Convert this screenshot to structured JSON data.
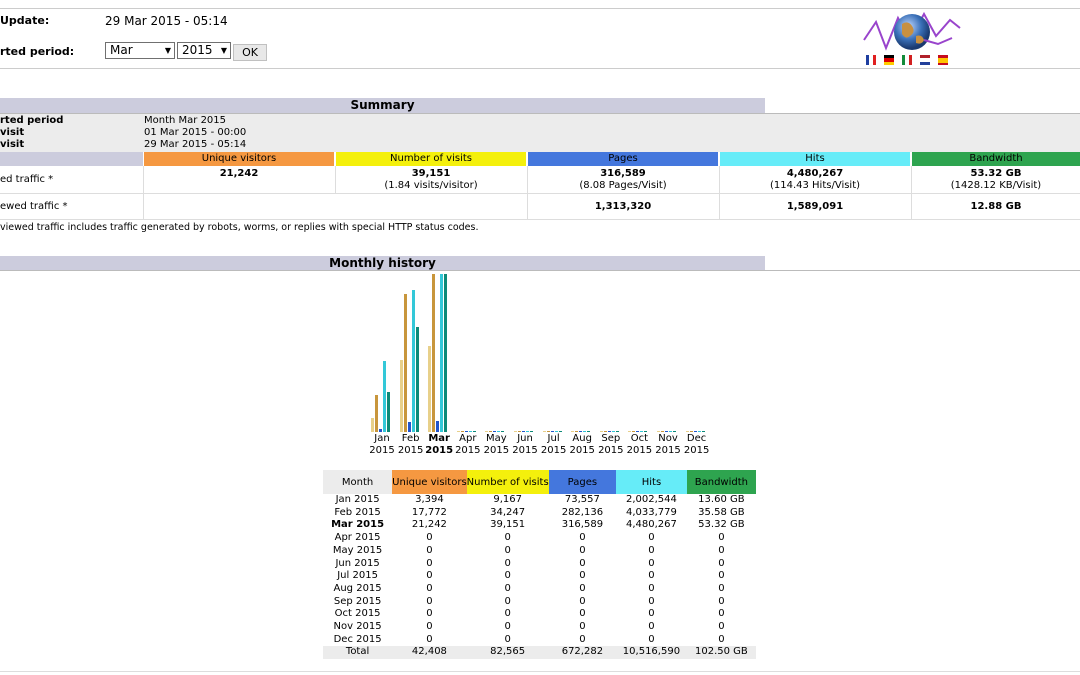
{
  "header": {
    "last_update_label": "Update:",
    "last_update_value": "29 Mar 2015 - 05:14",
    "period_label": "rted period:",
    "month_select": "Mar",
    "year_select": "2015",
    "ok_button": "OK",
    "logo_icon": "awstats-globe-logo",
    "flags": [
      "flag-fr-icon",
      "flag-de-icon",
      "flag-it-icon",
      "flag-nl-icon",
      "flag-es-icon"
    ]
  },
  "summary": {
    "title": "Summary",
    "info": [
      {
        "label": "rted period",
        "value": "Month Mar 2015"
      },
      {
        "label": "visit",
        "value": "01 Mar 2015 - 00:00"
      },
      {
        "label": "visit",
        "value": "29 Mar 2015 - 05:14"
      }
    ],
    "columns": [
      "Unique visitors",
      "Number of visits",
      "Pages",
      "Hits",
      "Bandwidth"
    ],
    "colors": {
      "visitors": "#f59841",
      "visits": "#f4f00c",
      "pages": "#4477dd",
      "hits": "#66ecf8",
      "bandwidth": "#2ea44f"
    },
    "viewed": {
      "label": "ed traffic *",
      "visitors": "21,242",
      "visits": "39,151",
      "visits_sub": "(1.84 visits/visitor)",
      "pages": "316,589",
      "pages_sub": "(8.08 Pages/Visit)",
      "hits": "4,480,267",
      "hits_sub": "(114.43 Hits/Visit)",
      "bandwidth": "53.32 GB",
      "bandwidth_sub": "(1428.12 KB/Visit)"
    },
    "notviewed": {
      "label": "ewed traffic *",
      "pages": "1,313,320",
      "hits": "1,589,091",
      "bandwidth": "12.88 GB"
    },
    "footnote": "viewed traffic includes traffic generated by robots, worms, or replies with special HTTP status codes."
  },
  "monthly": {
    "title": "Monthly history",
    "chart_labels": [
      [
        "Jan",
        "2015"
      ],
      [
        "Feb",
        "2015"
      ],
      [
        "Mar",
        "2015"
      ],
      [
        "Apr",
        "2015"
      ],
      [
        "May",
        "2015"
      ],
      [
        "Jun",
        "2015"
      ],
      [
        "Jul",
        "2015"
      ],
      [
        "Aug",
        "2015"
      ],
      [
        "Sep",
        "2015"
      ],
      [
        "Oct",
        "2015"
      ],
      [
        "Nov",
        "2015"
      ],
      [
        "Dec",
        "2015"
      ]
    ],
    "table_header": [
      "Month",
      "Unique visitors",
      "Number of visits",
      "Pages",
      "Hits",
      "Bandwidth"
    ],
    "rows": [
      [
        "Jan 2015",
        "3,394",
        "9,167",
        "73,557",
        "2,002,544",
        "13.60 GB"
      ],
      [
        "Feb 2015",
        "17,772",
        "34,247",
        "282,136",
        "4,033,779",
        "35.58 GB"
      ],
      [
        "Mar 2015",
        "21,242",
        "39,151",
        "316,589",
        "4,480,267",
        "53.32 GB"
      ],
      [
        "Apr 2015",
        "0",
        "0",
        "0",
        "0",
        "0"
      ],
      [
        "May 2015",
        "0",
        "0",
        "0",
        "0",
        "0"
      ],
      [
        "Jun 2015",
        "0",
        "0",
        "0",
        "0",
        "0"
      ],
      [
        "Jul 2015",
        "0",
        "0",
        "0",
        "0",
        "0"
      ],
      [
        "Aug 2015",
        "0",
        "0",
        "0",
        "0",
        "0"
      ],
      [
        "Sep 2015",
        "0",
        "0",
        "0",
        "0",
        "0"
      ],
      [
        "Oct 2015",
        "0",
        "0",
        "0",
        "0",
        "0"
      ],
      [
        "Nov 2015",
        "0",
        "0",
        "0",
        "0",
        "0"
      ],
      [
        "Dec 2015",
        "0",
        "0",
        "0",
        "0",
        "0"
      ]
    ],
    "total": [
      "Total",
      "42,408",
      "82,565",
      "672,282",
      "10,516,590",
      "102.50 GB"
    ]
  },
  "chart_data": {
    "type": "bar",
    "categories": [
      "Jan 2015",
      "Feb 2015",
      "Mar 2015",
      "Apr 2015",
      "May 2015",
      "Jun 2015",
      "Jul 2015",
      "Aug 2015",
      "Sep 2015",
      "Oct 2015",
      "Nov 2015",
      "Dec 2015"
    ],
    "series": [
      {
        "name": "Unique visitors",
        "color": "#e8d08a",
        "values": [
          3394,
          17772,
          21242,
          0,
          0,
          0,
          0,
          0,
          0,
          0,
          0,
          0
        ]
      },
      {
        "name": "Number of visits",
        "color": "#c8963c",
        "values": [
          9167,
          34247,
          39151,
          0,
          0,
          0,
          0,
          0,
          0,
          0,
          0,
          0
        ]
      },
      {
        "name": "Pages",
        "color": "#2255cc",
        "values": [
          73557,
          282136,
          316589,
          0,
          0,
          0,
          0,
          0,
          0,
          0,
          0,
          0
        ]
      },
      {
        "name": "Hits",
        "color": "#33c8d8",
        "values": [
          2002544,
          4033779,
          4480267,
          0,
          0,
          0,
          0,
          0,
          0,
          0,
          0,
          0
        ]
      },
      {
        "name": "Bandwidth",
        "color": "#0c8a78",
        "values": [
          13.6,
          35.58,
          53.32,
          0,
          0,
          0,
          0,
          0,
          0,
          0,
          0,
          0
        ]
      }
    ],
    "ylim_groups": {
      "visitors_visits": [
        0,
        39151
      ],
      "pages_hits": [
        0,
        4480267
      ],
      "bandwidth": [
        0,
        53.32
      ]
    }
  }
}
